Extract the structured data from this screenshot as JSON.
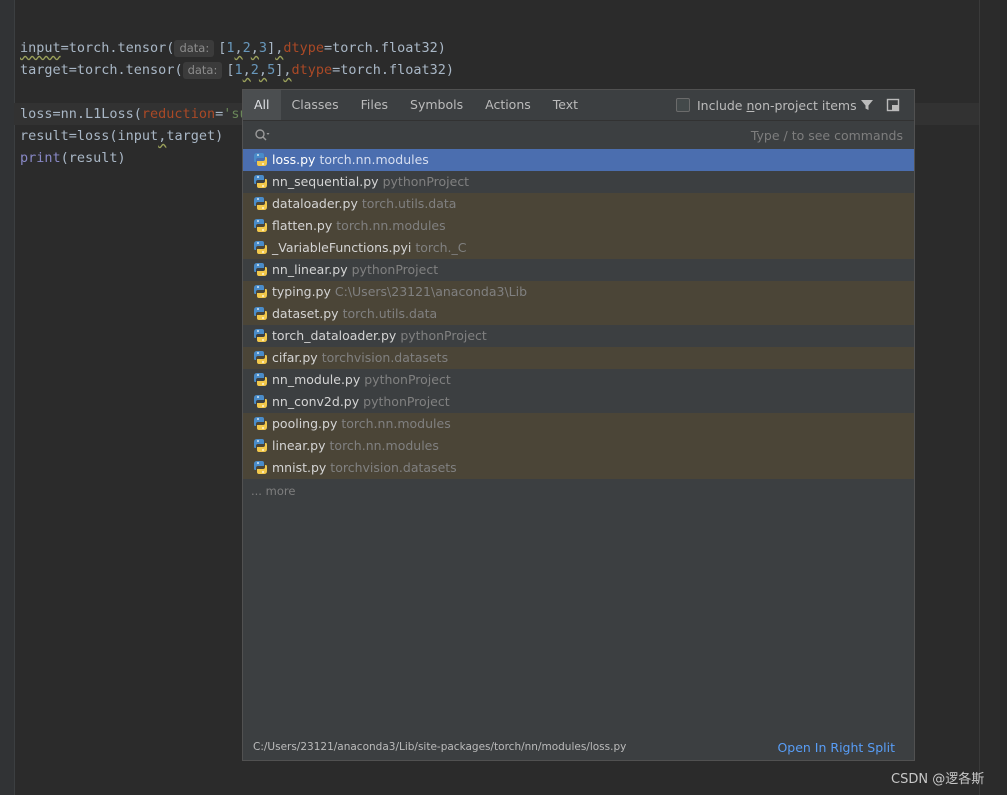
{
  "editor": {
    "line1": {
      "a": "input",
      "b": "=torch.tensor(",
      "hint": "data:",
      "c": "[",
      "n1": "1",
      "s1": ",",
      "n2": "2",
      "s2": ",",
      "n3": "3",
      "d": "]",
      ",": ",",
      "kw": "dtype",
      "e": "=torch.float32)"
    },
    "line2": {
      "a": "target",
      "b": "=torch.tensor(",
      "hint": "data:",
      "c": "[",
      "n1": "1",
      "s1": ",",
      "n2": "2",
      "s2": ",",
      "n3": "5",
      "d": "]",
      ",": ",",
      "kw": "dtype",
      "e": "=torch.float32)"
    },
    "line3": {
      "a": "loss",
      "b": "=nn.L1Loss(",
      "kw": "reduction",
      "eq": "=",
      "str": "'su"
    },
    "line4": {
      "a": "result",
      "b": "=loss(input",
      ",": ",",
      "c": "target)"
    },
    "line5": {
      "a": "print",
      "b": "(result)"
    }
  },
  "popup": {
    "tabs": [
      "All",
      "Classes",
      "Files",
      "Symbols",
      "Actions",
      "Text"
    ],
    "active_tab": "All",
    "include_label_pre": "Include ",
    "include_label_u": "n",
    "include_label_post": "on-project items",
    "search_placeholder": "",
    "search_hint": "Type / to see commands",
    "results": [
      {
        "name": "loss.py",
        "loc": "torch.nn.modules",
        "kind": "sel"
      },
      {
        "name": "nn_sequential.py",
        "loc": "pythonProject",
        "kind": "proj"
      },
      {
        "name": "dataloader.py",
        "loc": "torch.utils.data",
        "kind": "lib"
      },
      {
        "name": "flatten.py",
        "loc": "torch.nn.modules",
        "kind": "lib"
      },
      {
        "name": "_VariableFunctions.pyi",
        "loc": "torch._C",
        "kind": "lib"
      },
      {
        "name": "nn_linear.py",
        "loc": "pythonProject",
        "kind": "proj"
      },
      {
        "name": "typing.py",
        "loc": "C:\\Users\\23121\\anaconda3\\Lib",
        "kind": "lib"
      },
      {
        "name": "dataset.py",
        "loc": "torch.utils.data",
        "kind": "lib"
      },
      {
        "name": "torch_dataloader.py",
        "loc": "pythonProject",
        "kind": "proj"
      },
      {
        "name": "cifar.py",
        "loc": "torchvision.datasets",
        "kind": "lib"
      },
      {
        "name": "nn_module.py",
        "loc": "pythonProject",
        "kind": "proj"
      },
      {
        "name": "nn_conv2d.py",
        "loc": "pythonProject",
        "kind": "proj"
      },
      {
        "name": "pooling.py",
        "loc": "torch.nn.modules",
        "kind": "lib"
      },
      {
        "name": "linear.py",
        "loc": "torch.nn.modules",
        "kind": "lib"
      },
      {
        "name": "mnist.py",
        "loc": "torchvision.datasets",
        "kind": "lib"
      }
    ],
    "more_label": "... more",
    "footer_path": "C:/Users/23121/anaconda3/Lib/site-packages/torch/nn/modules/loss.py",
    "footer_link": "Open In Right Split"
  },
  "watermark": "CSDN @逻各斯",
  "colors": {
    "selection": "#4b6eaf",
    "library_row": "#4b4537",
    "link": "#589df6"
  }
}
